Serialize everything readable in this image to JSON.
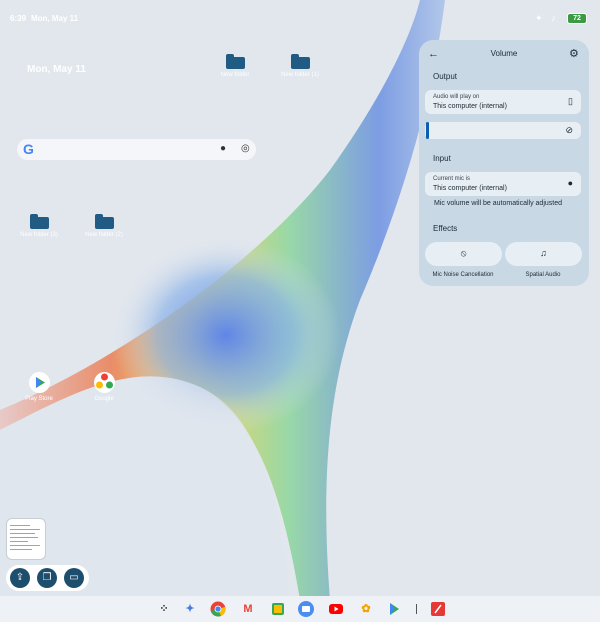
{
  "status_bar": {
    "time": "6:39",
    "date": "Mon, May 11",
    "battery": "72"
  },
  "desktop": {
    "date_widget": "Mon, May 11",
    "folders": [
      {
        "label": "New folder"
      },
      {
        "label": "New folder (1)"
      },
      {
        "label": "New folder (3)"
      },
      {
        "label": "New folder (2)"
      }
    ],
    "apps": [
      {
        "label": "Play Store"
      },
      {
        "label": "Google"
      }
    ]
  },
  "volume_panel": {
    "title": "Volume",
    "output_heading": "Output",
    "output_caption": "Audio will play on",
    "output_device": "This computer (internal)",
    "output_level": 0.0,
    "input_heading": "Input",
    "input_caption": "Current mic is",
    "input_device": "This computer (internal)",
    "auto_note": "Mic volume will be automatically adjusted",
    "effects_heading": "Effects",
    "effect_noise": "Mic Noise Cancellation",
    "effect_spatial": "Spatial Audio"
  },
  "icons": {
    "wifi": "wifi-icon",
    "notification": "bell-icon",
    "gear": "gear-icon"
  },
  "colors": {
    "accent": "#0b5fae",
    "panel": "#c9d8e5",
    "folder": "#1f5b83"
  }
}
